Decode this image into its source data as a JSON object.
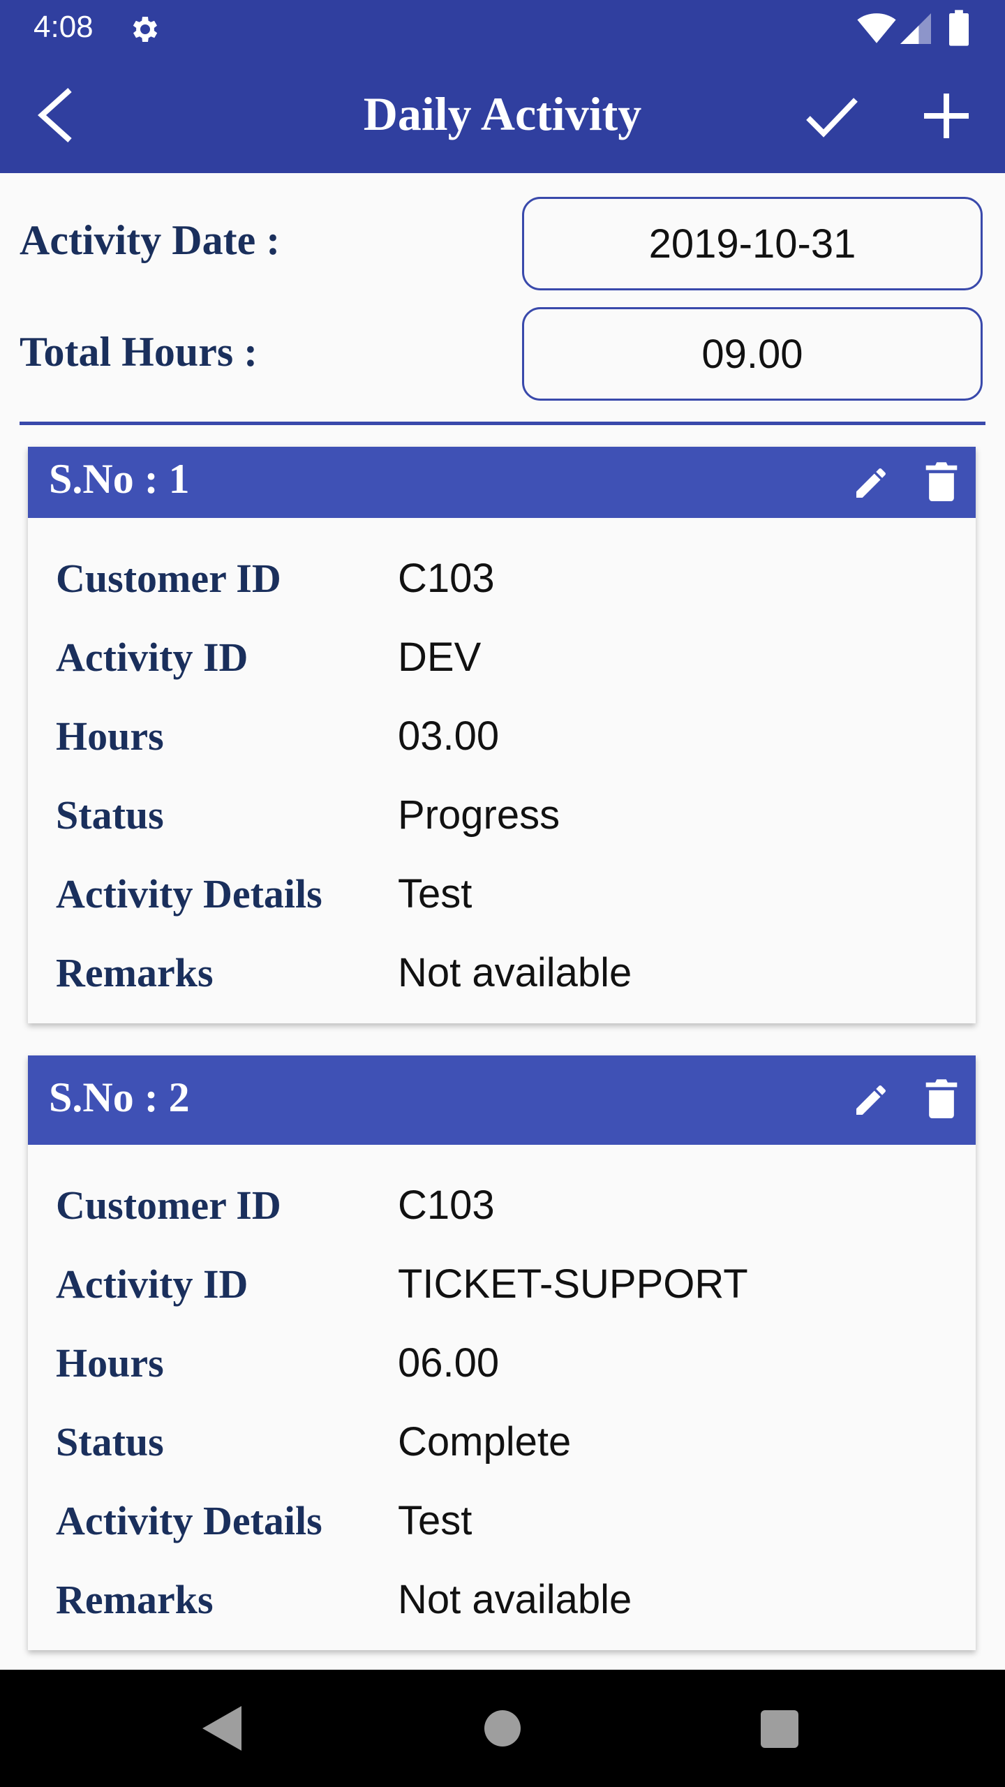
{
  "status_bar": {
    "time": "4:08"
  },
  "app_bar": {
    "title": "Daily Activity"
  },
  "form": {
    "activity_date_label": "Activity Date :",
    "activity_date_value": "2019-10-31",
    "total_hours_label": "Total Hours :",
    "total_hours_value": "09.00"
  },
  "labels": {
    "customer_id": "Customer ID",
    "activity_id": "Activity ID",
    "hours": "Hours",
    "status": "Status",
    "activity_details": "Activity Details",
    "remarks": "Remarks"
  },
  "entries": [
    {
      "title": "S.No : 1",
      "customer_id": "C103",
      "activity_id": "DEV",
      "hours": "03.00",
      "status": "Progress",
      "activity_details": "Test",
      "remarks": "Not available"
    },
    {
      "title": "S.No : 2",
      "customer_id": "C103",
      "activity_id": "TICKET-SUPPORT",
      "hours": "06.00",
      "status": "Complete",
      "activity_details": "Test",
      "remarks": "Not available"
    }
  ],
  "icons": {
    "status": [
      "gear-icon",
      "wifi-icon",
      "cell-signal-icon",
      "battery-icon"
    ],
    "app_bar": [
      "back-arrow-icon",
      "check-icon",
      "plus-icon"
    ],
    "card": [
      "pencil-icon",
      "trash-icon"
    ],
    "nav": [
      "nav-back-icon",
      "nav-home-icon",
      "nav-recents-icon"
    ]
  },
  "colors": {
    "app_bar": "#303f9f",
    "card_header": "#3f51b5",
    "label_text": "#1a2f5c",
    "field_border": "#3949ab"
  }
}
